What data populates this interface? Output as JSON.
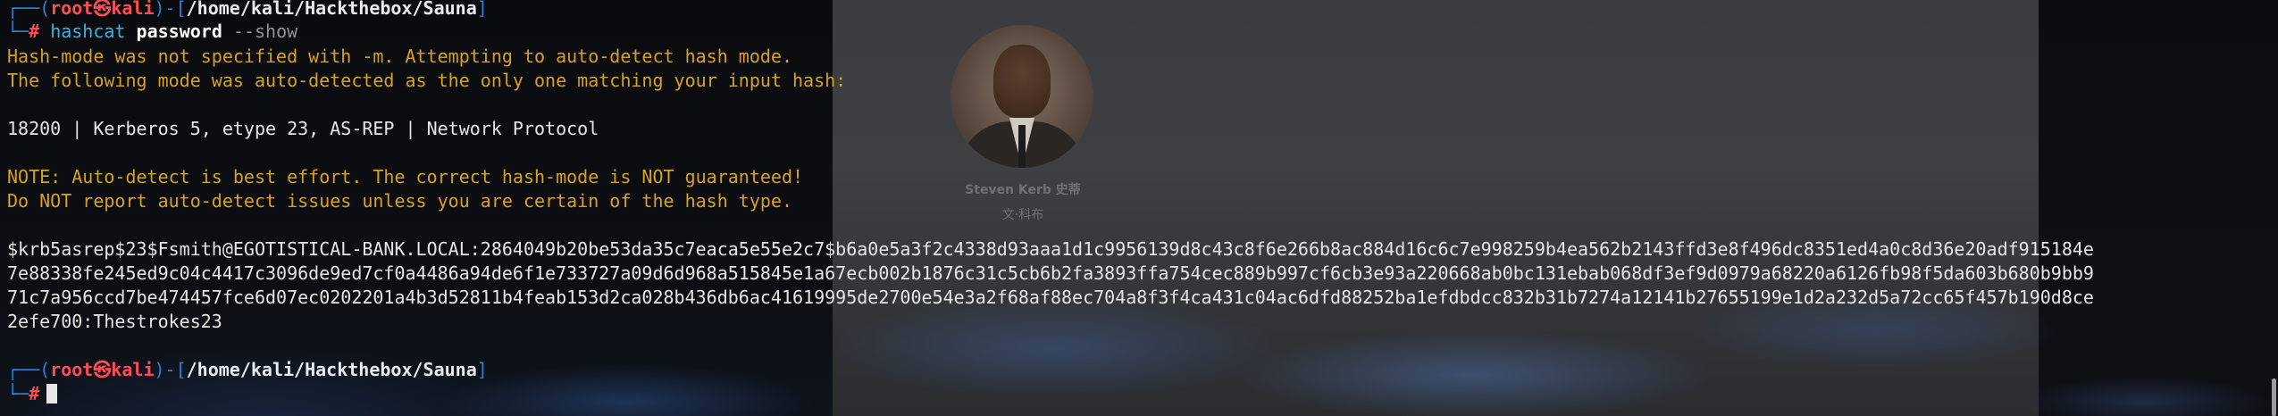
{
  "background": {
    "photo_caption": "Steven Kerb   史蒂",
    "photo_subcaption": "文·科布"
  },
  "prompt": {
    "corner_top": "┌──",
    "corner_bottom": "└─",
    "open": "(",
    "user": "root㉿kali",
    "close": ")-[",
    "path": "/home/kali/Hackthebox/Sauna",
    "end": "]",
    "symbol": "#"
  },
  "command": {
    "program": "hashcat",
    "argument": "password",
    "flag": "--show"
  },
  "output": {
    "warn1": "Hash-mode was not specified with -m. Attempting to auto-detect hash mode.",
    "warn2": "The following mode was auto-detected as the only one matching your input hash:",
    "mode": "18200 | Kerberos 5, etype 23, AS-REP | Network Protocol",
    "note1": "NOTE: Auto-detect is best effort. The correct hash-mode is NOT guaranteed!",
    "note2": "Do NOT report auto-detect issues unless you are certain of the hash type.",
    "hash_lines": [
      "$krb5asrep$23$Fsmith@EGOTISTICAL-BANK.LOCAL:2864049b20be53da35c7eaca5e55e2c7$b6a0e5a3f2c4338d93aaa1d1c9956139d8c43c8f6e266b8ac884d16c6c7e998259b4ea562b2143ffd3e8f496dc8351ed4a0c8d36e20adf915184e",
      "7e88338fe245ed9c04c4417c3096de9ed7cf0a4486a94de6f1e733727a09d6d968a515845e1a67ecb002b1876c31c5cb6b2fa3893ffa754cec889b997cf6cb3e93a220668ab0bc131ebab068df3ef9d0979a68220a6126fb98f5da603b680b9bb9",
      "71c7a956ccd7be474457fce6d07ec0202201a4b3d52811b4feab153d2ca028b436db6ac41619995de2700e54e3a2f68af88ec704a8f3f4ca431c04ac6dfd88252ba1efdbdcc832b31b7274a12141b27655199e1d2a232d5a72cc65f457b190d8ce",
      "2efe700:Thestrokes23"
    ]
  },
  "colors": {
    "prompt_frame": "#2f7fd6",
    "user": "#ff4d55",
    "command": "#3bb3e0",
    "warning": "#d6a21f",
    "text": "#e6e6e6"
  }
}
